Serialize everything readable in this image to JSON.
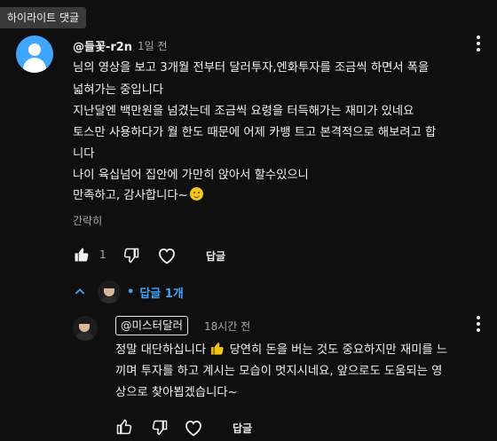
{
  "section_badge": "하이라이트 댓글",
  "comment": {
    "author": "@들꽃-r2n",
    "time": "1일 전",
    "lines": [
      "님의 영상을 보고 3개월 전부터 달러투자,엔화투자를 조금씩 하면서 폭을",
      "넓혀가는 중입니다",
      "지난달엔 백만원을 넘겼는데 조금씩 요령을 터득해가는 재미가 있네요",
      "토스만 사용하다가 월 한도 때문에 어제 카뱅 트고 본격적으로 해보려고 합",
      "니다",
      "나이 육십넘어 집안에 가만히 앉아서 할수있으니",
      "만족하고, 감사합니다~"
    ],
    "emoji": "smiling-face-emoji",
    "collapse_label": "간략히",
    "like_count": "1",
    "reply_label": "답글"
  },
  "replies_toggle": {
    "label": "답글 1개"
  },
  "reply": {
    "mention": "@미스터달러",
    "time": "18시간 전",
    "line1_before": "정말 대단하십니다",
    "line1_after": "당연히 돈을 버는 것도 중요하지만 재미를 느",
    "line2": "끼며 투자를 하고 계시는 모습이 멋지시네요, 앞으로도 도움되는 영",
    "line3": "상으로 찾아뵙겠습니다~",
    "emoji": "thumbs-up-emoji",
    "reply_label": "답글"
  },
  "colors": {
    "background": "#0f0f0f",
    "text": "#f1f1f1",
    "secondary_text": "#aaaaaa",
    "accent_blue": "#3ea6ff",
    "badge_bg": "#3a3a3a"
  }
}
